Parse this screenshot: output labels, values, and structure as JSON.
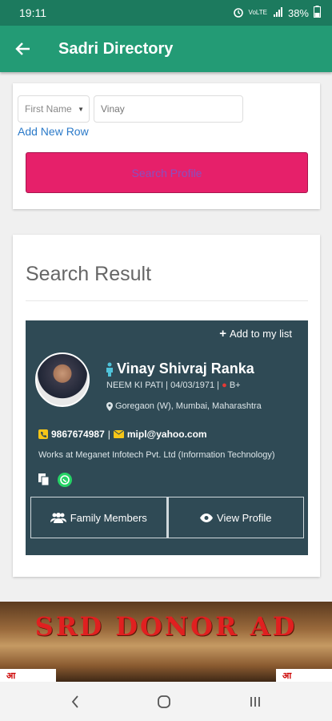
{
  "status_bar": {
    "time": "19:11",
    "battery": "38%"
  },
  "app_bar": {
    "title": "Sadri Directory"
  },
  "search_form": {
    "field_select": "First Name",
    "field_value": "Vinay",
    "add_row_label": "Add New Row",
    "search_button": "Search Profile"
  },
  "results": {
    "heading": "Search Result",
    "card": {
      "add_to_list": "Add to my list",
      "name": "Vinay Shivraj Ranka",
      "meta_prefix": "NEEM KI PATI | 04/03/1971 |",
      "blood_group": "B+",
      "location": "Goregaon (W), Mumbai, Maharashtra",
      "phone": "9867674987",
      "separator": "|",
      "email": "mipl@yahoo.com",
      "works": "Works at Meganet Infotech Pvt. Ltd (Information Technology)",
      "family_button": "Family Members",
      "view_profile_button": "View Profile"
    }
  },
  "ad_banner": {
    "text": "SRD DONOR AD"
  },
  "colors": {
    "status_bar": "#1c7a5e",
    "app_bar": "#239b75",
    "search_button": "#e6206a",
    "result_card": "#2f4a55"
  }
}
